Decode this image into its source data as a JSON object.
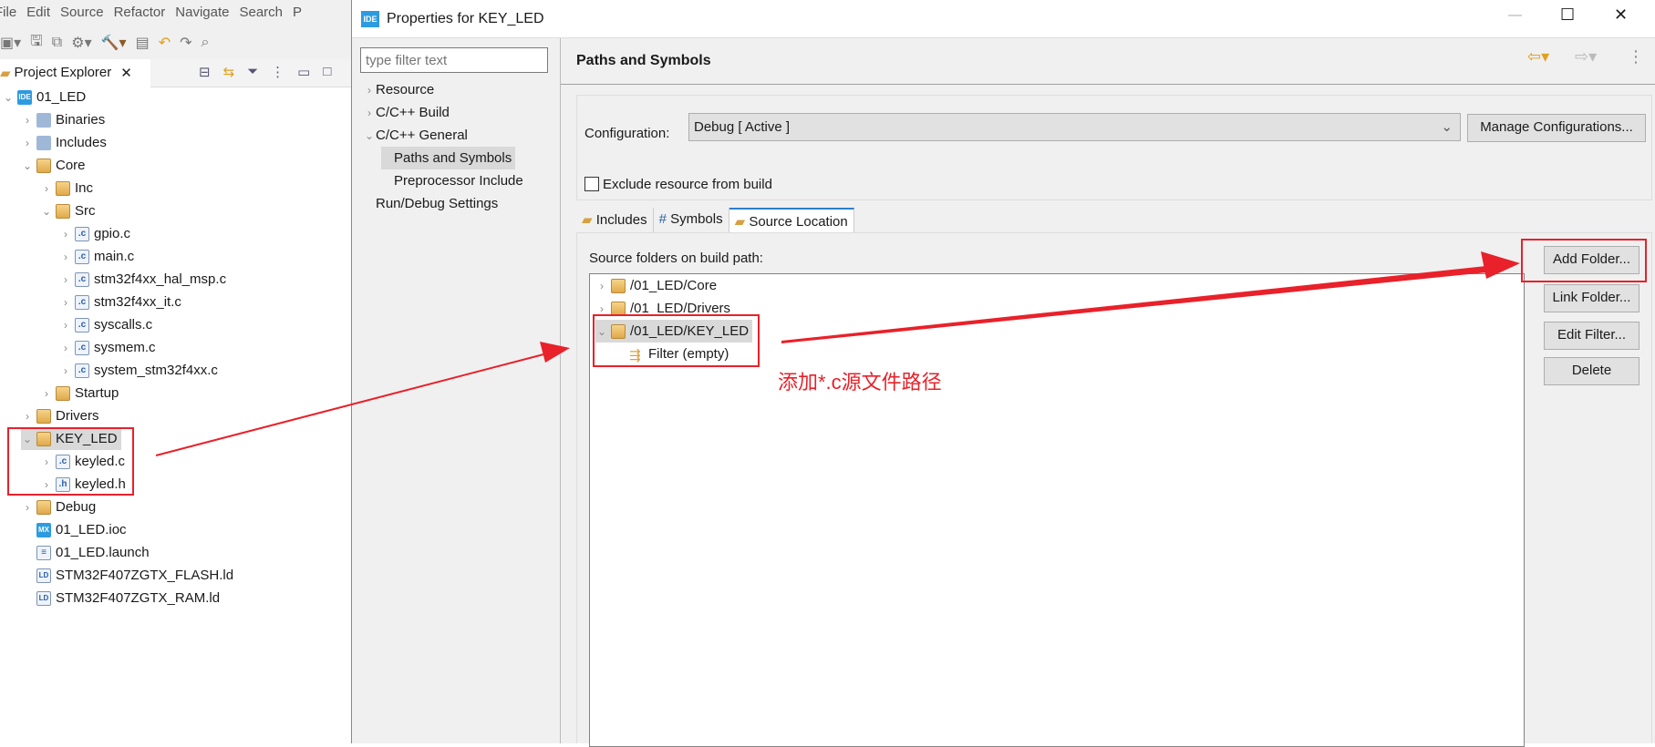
{
  "ide": {
    "menu": [
      "File",
      "Edit",
      "Source",
      "Refactor",
      "Navigate",
      "Search",
      "P"
    ],
    "explorer_tab": "Project Explorer",
    "tree": [
      {
        "label": "01_LED",
        "level": 0,
        "icon": "project-icon",
        "chev": "v"
      },
      {
        "label": "Binaries",
        "level": 1,
        "icon": "binaries-icon",
        "chev": ">"
      },
      {
        "label": "Includes",
        "level": 1,
        "icon": "includes-icon",
        "chev": ">"
      },
      {
        "label": "Core",
        "level": 1,
        "icon": "source-folder-icon",
        "chev": "v"
      },
      {
        "label": "Inc",
        "level": 2,
        "icon": "folder-icon",
        "chev": ">"
      },
      {
        "label": "Src",
        "level": 2,
        "icon": "folder-icon",
        "chev": "v"
      },
      {
        "label": "gpio.c",
        "level": 3,
        "icon": "c-file-icon",
        "chev": ">"
      },
      {
        "label": "main.c",
        "level": 3,
        "icon": "c-file-icon",
        "chev": ">"
      },
      {
        "label": "stm32f4xx_hal_msp.c",
        "level": 3,
        "icon": "c-file-icon",
        "chev": ">"
      },
      {
        "label": "stm32f4xx_it.c",
        "level": 3,
        "icon": "c-file-icon",
        "chev": ">"
      },
      {
        "label": "syscalls.c",
        "level": 3,
        "icon": "c-file-icon",
        "chev": ">"
      },
      {
        "label": "sysmem.c",
        "level": 3,
        "icon": "c-file-icon",
        "chev": ">"
      },
      {
        "label": "system_stm32f4xx.c",
        "level": 3,
        "icon": "c-file-icon",
        "chev": ">"
      },
      {
        "label": "Startup",
        "level": 2,
        "icon": "folder-icon",
        "chev": ">"
      },
      {
        "label": "Drivers",
        "level": 1,
        "icon": "source-folder-icon",
        "chev": ">"
      },
      {
        "label": "KEY_LED",
        "level": 1,
        "icon": "source-folder-icon",
        "chev": "v",
        "selected": true
      },
      {
        "label": "keyled.c",
        "level": 2,
        "icon": "c-file-icon",
        "chev": ">"
      },
      {
        "label": "keyled.h",
        "level": 2,
        "icon": "h-file-icon",
        "chev": ">"
      },
      {
        "label": "Debug",
        "level": 1,
        "icon": "folder-icon",
        "chev": ">"
      },
      {
        "label": "01_LED.ioc",
        "level": 1,
        "icon": "mx-file-icon",
        "chev": ""
      },
      {
        "label": "01_LED.launch",
        "level": 1,
        "icon": "launch-file-icon",
        "chev": ""
      },
      {
        "label": "STM32F407ZGTX_FLASH.ld",
        "level": 1,
        "icon": "ld-file-icon",
        "chev": ""
      },
      {
        "label": "STM32F407ZGTX_RAM.ld",
        "level": 1,
        "icon": "ld-file-icon",
        "chev": ""
      }
    ]
  },
  "dialog": {
    "title": "Properties for KEY_LED",
    "filter_placeholder": "type filter text",
    "nav": [
      {
        "label": "Resource",
        "level": 0,
        "chev": ">"
      },
      {
        "label": "C/C++ Build",
        "level": 0,
        "chev": ">"
      },
      {
        "label": "C/C++ General",
        "level": 0,
        "chev": "v"
      },
      {
        "label": "Paths and Symbols",
        "level": 1,
        "chev": "",
        "selected": true
      },
      {
        "label": "Preprocessor Include",
        "level": 1,
        "chev": ""
      },
      {
        "label": "Run/Debug Settings",
        "level": 0,
        "chev": ""
      }
    ],
    "page_title": "Paths and Symbols",
    "config_label": "Configuration:",
    "config_value": "Debug  [ Active ]",
    "manage_label": "Manage Configurations...",
    "exclude_label": "Exclude resource from build",
    "exclude_checked": false,
    "tabs": [
      "Includes",
      "Symbols",
      "Source Location"
    ],
    "active_tab": "Source Location",
    "source_label": "Source folders on build path:",
    "source_tree": [
      {
        "label": "/01_LED/Core",
        "level": 0,
        "chev": ">"
      },
      {
        "label": "/01_LED/Drivers",
        "level": 0,
        "chev": ">"
      },
      {
        "label": "/01_LED/KEY_LED",
        "level": 0,
        "chev": "v",
        "selected": true
      },
      {
        "label": "Filter (empty)",
        "level": 1,
        "chev": ""
      }
    ],
    "buttons": [
      "Add Folder...",
      "Link Folder...",
      "Edit Filter...",
      "Delete"
    ]
  },
  "annotation": {
    "text": "添加*.c源文件路径",
    "color": "#e8212a"
  }
}
